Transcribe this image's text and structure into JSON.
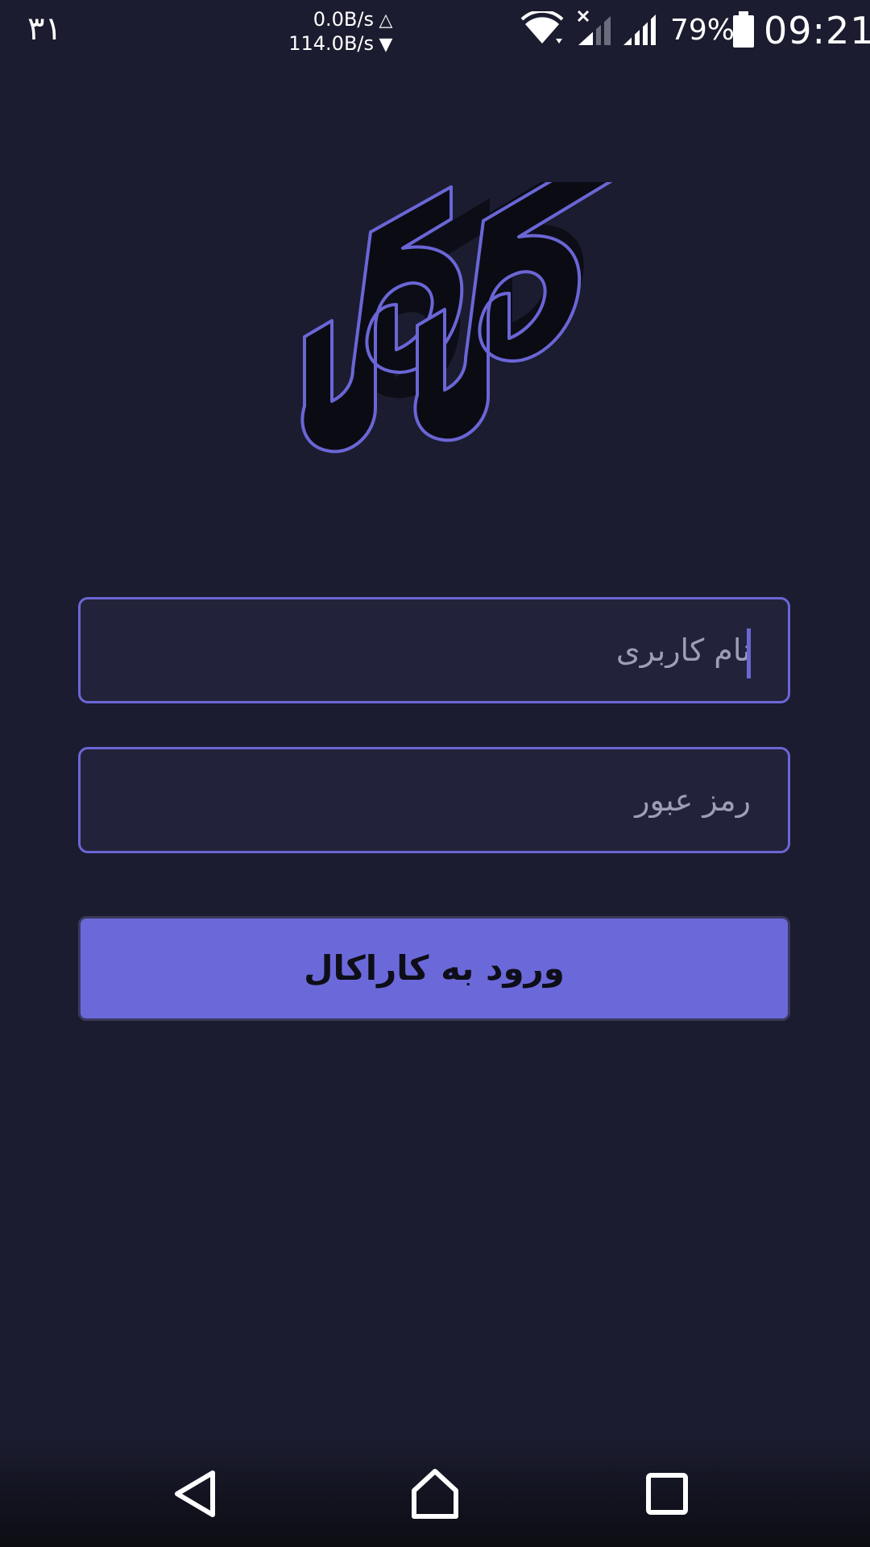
{
  "status_bar": {
    "notification_text": "۳۱",
    "upload_speed": "0.0B/s",
    "upload_arrow": "△",
    "download_speed": "114.0B/s",
    "download_arrow": "▼",
    "icons": [
      "wifi-icon",
      "signal-no-service-icon",
      "signal-icon",
      "battery-icon"
    ],
    "battery_percent": "79%",
    "time": "09:21"
  },
  "logo": {
    "text": "کاراکال",
    "icon": "app-logo"
  },
  "login_form": {
    "username_placeholder": "نام کاربری",
    "username_value": "",
    "password_placeholder": "رمز عبور",
    "password_value": "",
    "submit_label": "ورود به کاراکال"
  },
  "nav_bar": {
    "icons": [
      "back-icon",
      "home-icon",
      "recent-apps-icon"
    ]
  },
  "colors": {
    "background": "#1b1c2f",
    "accent": "#6b66d6",
    "button": "#6b69d9",
    "field_background": "#22233a",
    "placeholder": "#9c9db6"
  }
}
